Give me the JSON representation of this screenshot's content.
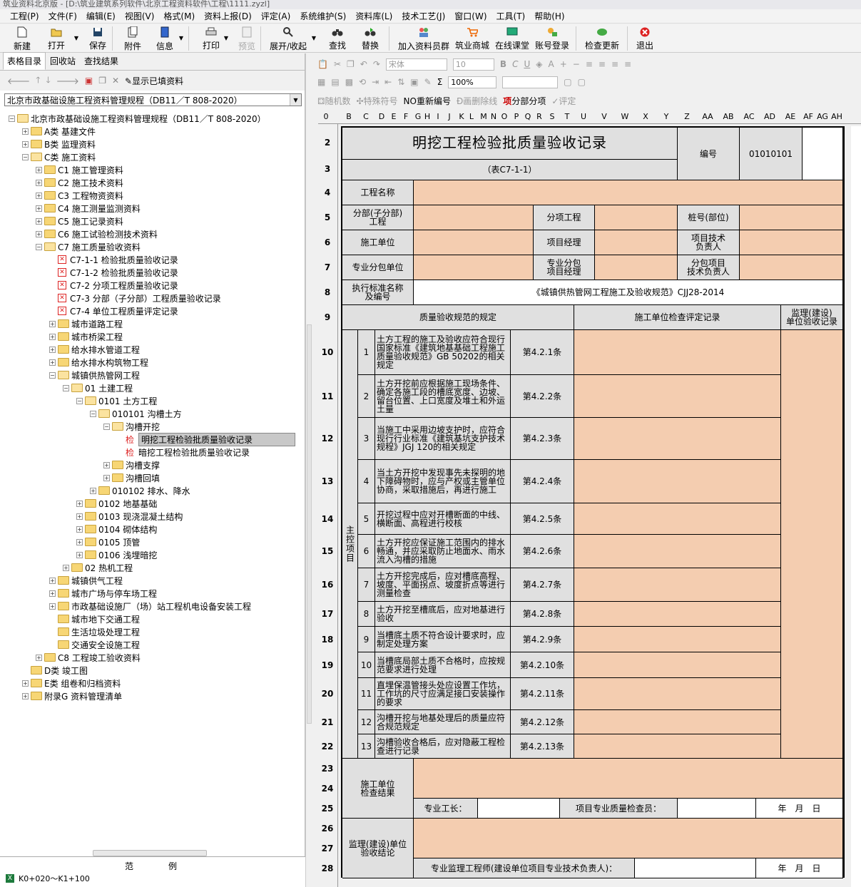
{
  "window_title": "筑业资料北京版 - [D:\\筑业建筑系列软件\\北京工程资料软件\\工程\\1111.zyzl]",
  "menu": [
    "工程(P)",
    "文件(F)",
    "编辑(E)",
    "视图(V)",
    "格式(M)",
    "资料上报(D)",
    "评定(A)",
    "系统维护(S)",
    "资料库(L)",
    "技术工艺(J)",
    "窗口(W)",
    "工具(T)",
    "帮助(H)"
  ],
  "toolbar": {
    "new": "新建",
    "open": "打开",
    "save": "保存",
    "attach": "附件",
    "info": "信息",
    "print": "打印",
    "preview": "预览",
    "expand": "展开/收起",
    "find": "查找",
    "replace": "替换",
    "join": "加入资料员群",
    "mall": "筑业商城",
    "class": "在线课堂",
    "login": "账号登录",
    "update": "检查更新",
    "exit": "退出"
  },
  "left_tabs": [
    "表格目录",
    "回收站",
    "查找结果"
  ],
  "show_filled": "显示已填资料",
  "spec_combo": "北京市政基础设施工程资料管理规程（DB11／T 808-2020）",
  "tree": [
    {
      "t": "北京市政基础设施工程资料管理规程（DB11／T 808-2020）",
      "d": 0,
      "k": "fo",
      "pm": "-"
    },
    {
      "t": "A类 基建文件",
      "d": 1,
      "k": "f",
      "pm": "+"
    },
    {
      "t": "B类 监理资料",
      "d": 1,
      "k": "f",
      "pm": "+"
    },
    {
      "t": "C类 施工资料",
      "d": 1,
      "k": "fo",
      "pm": "-"
    },
    {
      "t": "C1 施工管理资料",
      "d": 2,
      "k": "f",
      "pm": "+"
    },
    {
      "t": "C2 施工技术资料",
      "d": 2,
      "k": "f",
      "pm": "+"
    },
    {
      "t": "C3 工程物资资料",
      "d": 2,
      "k": "f",
      "pm": "+"
    },
    {
      "t": "C4 施工测量监测资料",
      "d": 2,
      "k": "f",
      "pm": "+"
    },
    {
      "t": "C5 施工记录资料",
      "d": 2,
      "k": "f",
      "pm": "+"
    },
    {
      "t": "C6 施工试验检测技术资料",
      "d": 2,
      "k": "f",
      "pm": "+"
    },
    {
      "t": "C7 施工质量验收资料",
      "d": 2,
      "k": "fo",
      "pm": "-"
    },
    {
      "t": "C7-1-1 检验批质量验收记录",
      "d": 3,
      "k": "x",
      "pm": ""
    },
    {
      "t": "C7-1-2 检验批质量验收记录",
      "d": 3,
      "k": "x",
      "pm": ""
    },
    {
      "t": "C7-2 分项工程质量验收记录",
      "d": 3,
      "k": "x",
      "pm": ""
    },
    {
      "t": "C7-3 分部（子分部）工程质量验收记录",
      "d": 3,
      "k": "x",
      "pm": ""
    },
    {
      "t": "C7-4 单位工程质量评定记录",
      "d": 3,
      "k": "x",
      "pm": ""
    },
    {
      "t": "城市道路工程",
      "d": 3,
      "k": "f",
      "pm": "+"
    },
    {
      "t": "城市桥梁工程",
      "d": 3,
      "k": "f",
      "pm": "+"
    },
    {
      "t": "给水排水管道工程",
      "d": 3,
      "k": "f",
      "pm": "+"
    },
    {
      "t": "给水排水构筑物工程",
      "d": 3,
      "k": "f",
      "pm": "+"
    },
    {
      "t": "城镇供热管网工程",
      "d": 3,
      "k": "fo",
      "pm": "-"
    },
    {
      "t": "01 土建工程",
      "d": 4,
      "k": "fo",
      "pm": "-"
    },
    {
      "t": "0101 土方工程",
      "d": 5,
      "k": "fo",
      "pm": "-"
    },
    {
      "t": "010101 沟槽土方",
      "d": 6,
      "k": "fo",
      "pm": "-"
    },
    {
      "t": "沟槽开挖",
      "d": 7,
      "k": "fo",
      "pm": "-"
    },
    {
      "t": "明挖工程检验批质量验收记录",
      "d": 8,
      "k": "j",
      "pm": "",
      "sel": true
    },
    {
      "t": "暗挖工程检验批质量验收记录",
      "d": 8,
      "k": "j",
      "pm": ""
    },
    {
      "t": "沟槽支撑",
      "d": 7,
      "k": "f",
      "pm": "+"
    },
    {
      "t": "沟槽回填",
      "d": 7,
      "k": "f",
      "pm": "+"
    },
    {
      "t": "010102 排水、降水",
      "d": 6,
      "k": "f",
      "pm": "+"
    },
    {
      "t": "0102 地基基础",
      "d": 5,
      "k": "f",
      "pm": "+"
    },
    {
      "t": "0103 现浇混凝土结构",
      "d": 5,
      "k": "f",
      "pm": "+"
    },
    {
      "t": "0104 砌体结构",
      "d": 5,
      "k": "f",
      "pm": "+"
    },
    {
      "t": "0105 顶管",
      "d": 5,
      "k": "f",
      "pm": "+"
    },
    {
      "t": "0106 浅埋暗挖",
      "d": 5,
      "k": "f",
      "pm": "+"
    },
    {
      "t": "02 热机工程",
      "d": 4,
      "k": "f",
      "pm": "+"
    },
    {
      "t": "城镇供气工程",
      "d": 3,
      "k": "f",
      "pm": "+"
    },
    {
      "t": "城市广场与停车场工程",
      "d": 3,
      "k": "f",
      "pm": "+"
    },
    {
      "t": "市政基础设施厂（场）站工程机电设备安装工程",
      "d": 3,
      "k": "f",
      "pm": "+"
    },
    {
      "t": "城市地下交通工程",
      "d": 3,
      "k": "f",
      "pm": ""
    },
    {
      "t": "生活垃圾处理工程",
      "d": 3,
      "k": "f",
      "pm": ""
    },
    {
      "t": "交通安全设施工程",
      "d": 3,
      "k": "f",
      "pm": ""
    },
    {
      "t": "C8 工程竣工验收资料",
      "d": 2,
      "k": "f",
      "pm": "+"
    },
    {
      "t": "D类 竣工图",
      "d": 1,
      "k": "f",
      "pm": ""
    },
    {
      "t": "E类 组卷和归档资料",
      "d": 1,
      "k": "f",
      "pm": "+"
    },
    {
      "t": "附录G 资料管理清单",
      "d": 1,
      "k": "f",
      "pm": "+"
    }
  ],
  "legend": {
    "title1": "范",
    "title2": "例",
    "item": "K0+020～K1+100"
  },
  "fmt_toolbar": {
    "font": "宋体",
    "size": "10",
    "zoom": "100%",
    "sigma": "Σ"
  },
  "toolbar3": [
    "随机数",
    "特殊符号",
    "重新编号",
    "画删除线",
    "分部分项",
    "评定"
  ],
  "toolbar3_prefix_no": "NO",
  "toolbar3_prefix_xiang": "项",
  "columns": [
    "0",
    "B",
    "C",
    "D",
    "E",
    "F",
    "G",
    "H",
    "I",
    "J",
    "K",
    "L",
    "M",
    "N",
    "O",
    "P",
    "Q",
    "R",
    "S",
    "T",
    "U",
    "V",
    "W",
    "X",
    "Y",
    "Z",
    "AA",
    "AB",
    "AC",
    "AD",
    "AE",
    "AF",
    "AG",
    "AH"
  ],
  "row_numbers": [
    "2",
    "3",
    "4",
    "5",
    "6",
    "7",
    "8",
    "9",
    "10",
    "11",
    "12",
    "13",
    "14",
    "15",
    "16",
    "17",
    "18",
    "19",
    "20",
    "21",
    "22",
    "23",
    "24",
    "25",
    "26",
    "27",
    "28"
  ],
  "form": {
    "title": "明挖工程检验批质量验收记录",
    "subtitle": "（表C7-1-1）",
    "code_label": "编号",
    "code_value": "01010101",
    "project_name": "工程名称",
    "sub_project": "分部(子分部)\n工程",
    "item_project": "分项工程",
    "pile_no": "桩号(部位)",
    "construct_unit": "施工单位",
    "pm": "项目经理",
    "tech_lead": "项目技术\n负责人",
    "sub_unit": "专业分包单位",
    "sub_pm": "专业分包\n项目经理",
    "sub_tech": "分包项目\n技术负责人",
    "standard_label": "执行标准名称\n及编号",
    "standard_value": "《城镇供热管网工程施工及验收规范》CJJ28-2014",
    "hdr_spec": "质量验收规范的规定",
    "hdr_check": "施工单位检查评定记录",
    "hdr_supervisor": "监理(建设)\n单位验收记录",
    "main_items_label": "主控项目",
    "items": [
      {
        "no": "1",
        "text": "土方工程的施工及验收应符合现行国家标准《建筑地基基础工程施工质量验收规范》GB 50202的相关规定",
        "clause": "第4.2.1条"
      },
      {
        "no": "2",
        "text": "土方开挖前应根据施工现场条件、确定各施工段的槽底宽度、边坡、留台位置、上口宽度及堆土和外运土量",
        "clause": "第4.2.2条"
      },
      {
        "no": "3",
        "text": "当施工中采用边坡支护时，应符合现行行业标准《建筑基坑支护技术规程》JGJ 120的相关规定",
        "clause": "第4.2.3条"
      },
      {
        "no": "4",
        "text": "当土方开挖中发现事先未探明的地下障碍物时，应与产权或主管单位协商，采取措施后，再进行施工",
        "clause": "第4.2.4条"
      },
      {
        "no": "5",
        "text": "开挖过程中应对开槽断面的中线、横断面、高程进行校核",
        "clause": "第4.2.5条"
      },
      {
        "no": "6",
        "text": "土方开挖应保证施工范围内的排水畅通，并应采取防止地面水、雨水流入沟槽的措施",
        "clause": "第4.2.6条"
      },
      {
        "no": "7",
        "text": "土方开挖完成后，应对槽底高程、坡度、平面拐点、坡度折点等进行测量检查",
        "clause": "第4.2.7条"
      },
      {
        "no": "8",
        "text": "土方开挖至槽底后，应对地基进行验收",
        "clause": "第4.2.8条"
      },
      {
        "no": "9",
        "text": "当槽底土质不符合设计要求时，应制定处理方案",
        "clause": "第4.2.9条"
      },
      {
        "no": "10",
        "text": "当槽底局部土质不合格时，应按规范要求进行处理",
        "clause": "第4.2.10条"
      },
      {
        "no": "11",
        "text": "直埋保温管接头处应设置工作坑，工作坑的尺寸应满足接口安装操作的要求",
        "clause": "第4.2.11条"
      },
      {
        "no": "12",
        "text": "沟槽开挖与地基处理后的质量应符合规范规定",
        "clause": "第4.2.12条"
      },
      {
        "no": "13",
        "text": "沟槽验收合格后，应对隐蔽工程检查进行记录",
        "clause": "第4.2.13条"
      }
    ],
    "construct_result": "施工单位\n检查结果",
    "foreman": "专业工长：",
    "inspector": "项目专业质量检查员：",
    "date": "年　月　日",
    "supervisor_conclusion": "监理(建设)单位\n验收结论",
    "supervisor_engineer": "专业监理工程师(建设单位项目专业技术负责人)：",
    "date2": "年　月　日"
  }
}
